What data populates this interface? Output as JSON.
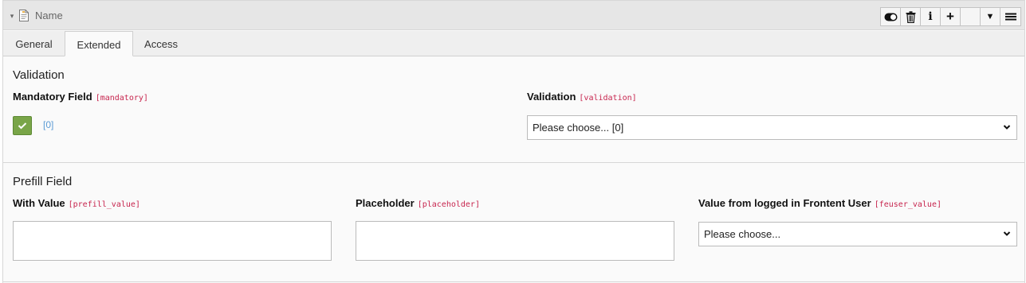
{
  "header": {
    "title": "Name",
    "toggle_glyph": "▾",
    "toolbar": [
      {
        "name": "toggle-visibility-icon"
      },
      {
        "name": "delete-icon"
      },
      {
        "name": "info-icon",
        "glyph": "i"
      },
      {
        "name": "plus-icon",
        "glyph": "+"
      },
      {
        "name": "empty-slot"
      },
      {
        "name": "caret-down-icon",
        "glyph": "▼"
      },
      {
        "name": "hamburger-menu-icon"
      }
    ]
  },
  "tabs": [
    {
      "label": "General"
    },
    {
      "label": "Extended",
      "active": true
    },
    {
      "label": "Access"
    }
  ],
  "validation": {
    "section_title": "Validation",
    "mandatory_label": "Mandatory Field",
    "mandatory_code": "[mandatory]",
    "mandatory_checked": true,
    "mandatory_value": "[0]",
    "validation_label": "Validation",
    "validation_code": "[validation]",
    "validation_selected": "Please choose... [0]"
  },
  "prefill": {
    "section_title": "Prefill Field",
    "with_value_label": "With Value",
    "with_value_code": "[prefill_value]",
    "with_value_value": "",
    "placeholder_label": "Placeholder",
    "placeholder_code": "[placeholder]",
    "placeholder_value": "",
    "feuser_label": "Value from logged in Frontent User",
    "feuser_code": "[feuser_value]",
    "feuser_selected": "Please choose..."
  },
  "colors": {
    "checkbox_green": "#79a548",
    "code_red": "#c7254e",
    "value_blue": "#5b9bd5"
  }
}
